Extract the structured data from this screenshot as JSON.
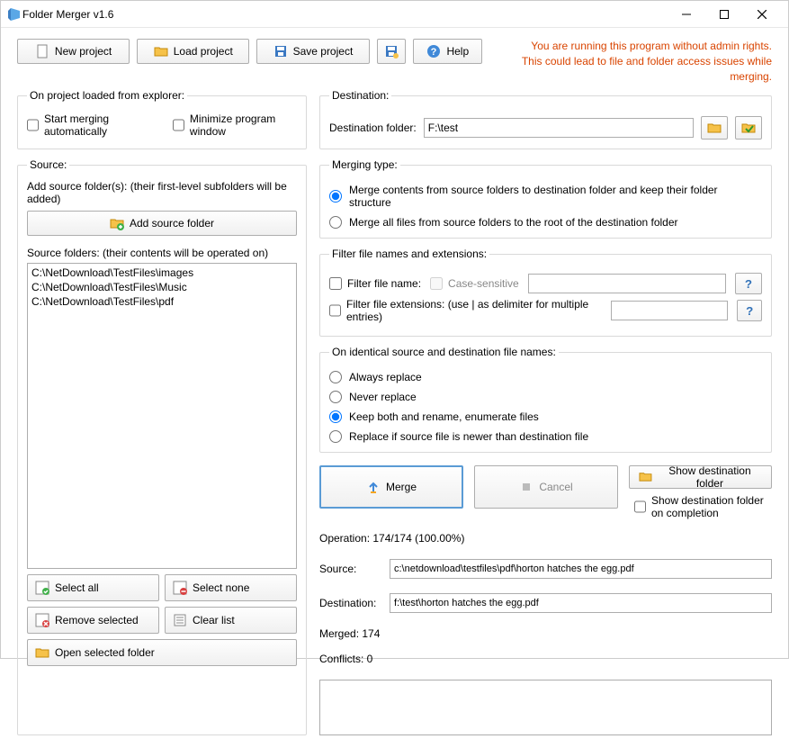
{
  "title": "Folder Merger v1.6",
  "warning_line1": "You are running this program without admin rights.",
  "warning_line2": "This could lead to file and folder access issues while merging.",
  "toolbar": {
    "new_project": "New project",
    "load_project": "Load project",
    "save_project": "Save project",
    "help": "Help"
  },
  "explorer_group": {
    "legend": "On project loaded from explorer:",
    "start_auto": "Start merging automatically",
    "min_window": "Minimize program window"
  },
  "source_group": {
    "legend": "Source:",
    "add_label": "Add source folder(s): (their first-level subfolders will be added)",
    "add_button": "Add source folder",
    "folders_label": "Source folders: (their contents will be operated on)",
    "folders": [
      "C:\\NetDownload\\TestFiles\\images",
      "C:\\NetDownload\\TestFiles\\Music",
      "C:\\NetDownload\\TestFiles\\pdf"
    ],
    "select_all": "Select all",
    "select_none": "Select none",
    "remove_selected": "Remove selected",
    "clear_list": "Clear list",
    "open_selected": "Open selected folder"
  },
  "destination_group": {
    "legend": "Destination:",
    "label": "Destination folder:",
    "value": "F:\\test"
  },
  "merging_type": {
    "legend": "Merging type:",
    "opt1": "Merge contents from source folders to destination folder and keep their folder structure",
    "opt2": "Merge all files from source folders to the root of the destination folder"
  },
  "filter": {
    "legend": "Filter file names and extensions:",
    "name_label": "Filter file name:",
    "case_label": "Case-sensitive",
    "ext_label": "Filter file extensions: (use | as delimiter for multiple entries)"
  },
  "identical": {
    "legend": "On identical source and destination file names:",
    "opt1": "Always replace",
    "opt2": "Never replace",
    "opt3": "Keep both and rename, enumerate files",
    "opt4": "Replace if source file is newer than destination file"
  },
  "actions": {
    "merge": "Merge",
    "cancel": "Cancel",
    "show_dest": "Show destination folder",
    "show_on_complete": "Show destination folder on completion"
  },
  "progress": {
    "operation": "Operation: 174/174 (100.00%)",
    "source_label": "Source:",
    "source_value": "c:\\netdownload\\testfiles\\pdf\\horton hatches the egg.pdf",
    "dest_label": "Destination:",
    "dest_value": "f:\\test\\horton hatches the egg.pdf",
    "merged": "Merged: 174",
    "conflicts": "Conflicts: 0"
  },
  "help_icon": "?"
}
